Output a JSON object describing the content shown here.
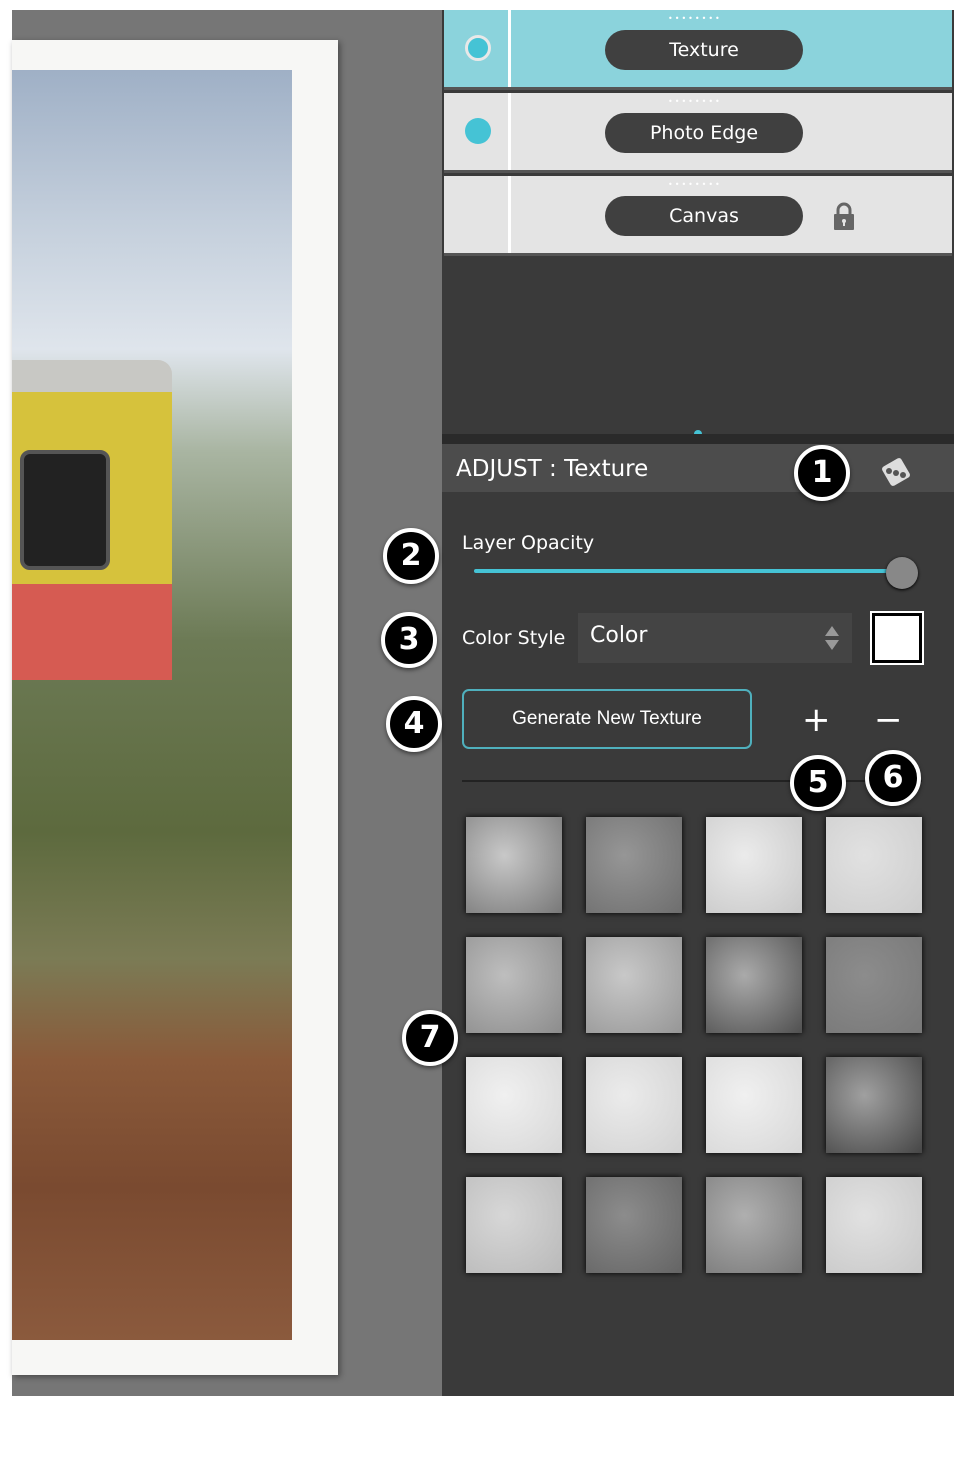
{
  "layers": [
    {
      "label": "Texture",
      "selected": true,
      "visible": true
    },
    {
      "label": "Photo Edge",
      "selected": false,
      "visible": true
    },
    {
      "label": "Canvas",
      "selected": false,
      "visible": false,
      "locked": true
    }
  ],
  "adjust": {
    "title": "ADJUST : Texture",
    "randomize_icon": "dice-icon",
    "layer_opacity_label": "Layer Opacity",
    "layer_opacity_value": 100,
    "color_style_label": "Color Style",
    "color_style_value": "Color",
    "swatch_color": "#ffffff",
    "generate_label": "Generate New Texture",
    "add_label": "+",
    "remove_label": "−"
  },
  "markers": [
    "1",
    "2",
    "3",
    "4",
    "5",
    "6",
    "7"
  ],
  "accent": "#45c3d5",
  "texture_count": 16
}
